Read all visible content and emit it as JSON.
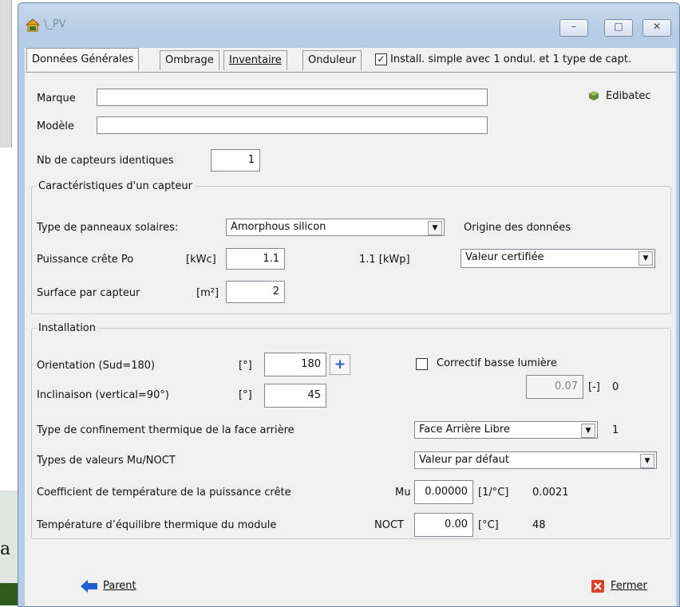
{
  "window": {
    "title": "\\_PV",
    "minimize_glyph": "–",
    "maximize_glyph": "□",
    "close_glyph": "✕"
  },
  "tabs": [
    {
      "label": "Données Générales",
      "active": true
    },
    {
      "label": "Ombrage",
      "active": false
    },
    {
      "label": "Inventaire",
      "active": false
    },
    {
      "label": "Onduleur",
      "active": false
    }
  ],
  "simple_install": {
    "checked": true,
    "label": "Install. simple avec 1 ondul. et 1 type de capt."
  },
  "general": {
    "marque_label": "Marque",
    "marque_value": "",
    "modele_label": "Modèle",
    "modele_value": "",
    "edibatec_label": "Edibatec",
    "nb_capteurs_label": "Nb de capteurs identiques",
    "nb_capteurs_value": "1"
  },
  "capteur": {
    "legend": "Caractéristiques d'un capteur",
    "type_label": "Type de panneaux solaires:",
    "type_value": "Amorphous silicon",
    "origine_label": "Origine des données",
    "origine_value": "Valeur certifiée",
    "puissance_label": "Puissance crête Po",
    "puissance_unit": "[kWc]",
    "puissance_value": "1.1",
    "puissance_kwp": "1.1  [kWp]",
    "surface_label": "Surface par capteur",
    "surface_unit": "[m²]",
    "surface_value": "2"
  },
  "installation": {
    "legend": "Installation",
    "orientation_label": "Orientation (Sud=180)",
    "orientation_unit": "[°]",
    "orientation_value": "180",
    "plus_label": "+",
    "inclinaison_label": "Inclinaison  (vertical=90°)",
    "inclinaison_unit": "[°]",
    "inclinaison_value": "45",
    "correctif_label": "Correctif basse lumière",
    "correctif_checked": false,
    "correctif_value": "0.07",
    "correctif_unit": "[-]",
    "correctif_extra": "0",
    "confinement_label": "Type de confinement thermique de la face arrière",
    "confinement_value": "Face Arrière Libre",
    "confinement_extra": "1",
    "mu_noct_label": "Types de valeurs Mu/NOCT",
    "mu_noct_value": "Valeur par défaut",
    "coef_label": "Coefficient de température de la puissance crête",
    "coef_symbol": "Mu",
    "coef_value": "0.00000",
    "coef_unit": "[1/°C]",
    "coef_extra": "0.0021",
    "temp_label": "Température d’équilibre thermique du module",
    "temp_symbol": "NOCT",
    "temp_value": "0.00",
    "temp_unit": "[°C]",
    "temp_extra": "48"
  },
  "footer": {
    "parent_label": "Parent",
    "fermer_label": "Fermer"
  },
  "background": {
    "letter": "a"
  },
  "colors": {
    "accent_blue": "#1e5fd1",
    "close_red": "#d9412a",
    "titlebar": "#c7d8ec"
  }
}
